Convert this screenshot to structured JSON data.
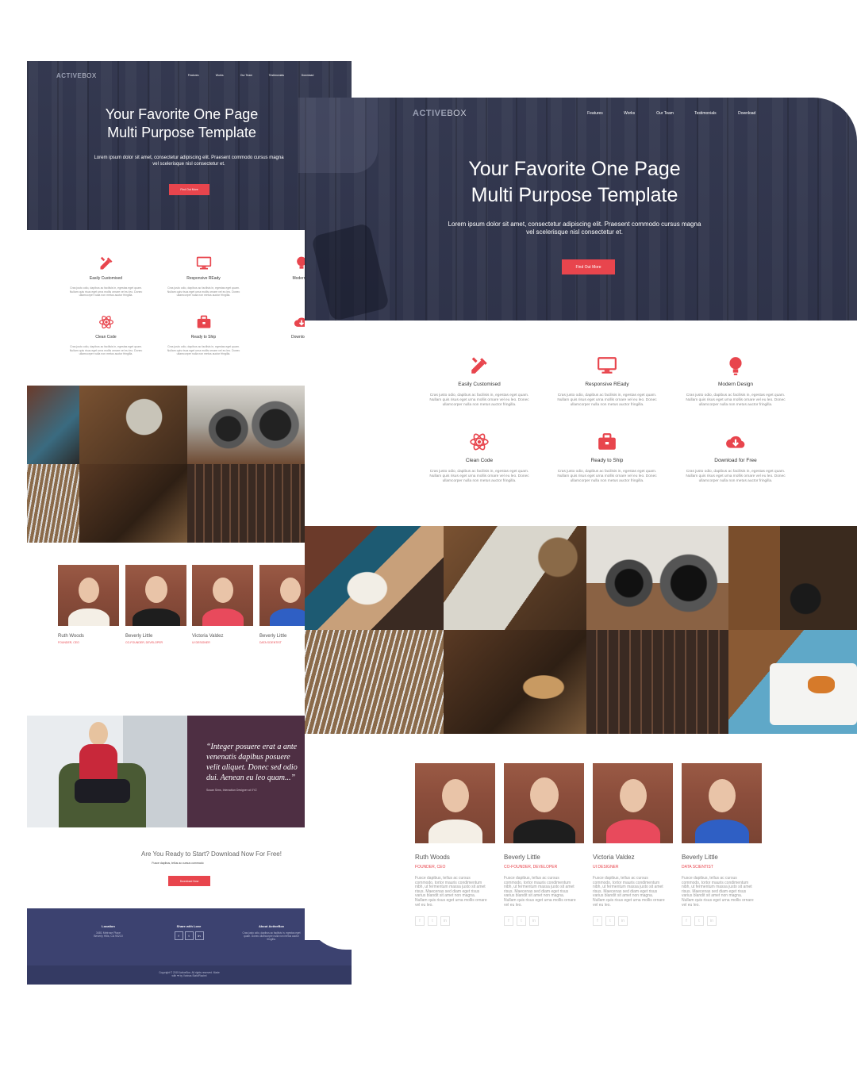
{
  "brand": {
    "part1": "ACTIVE",
    "part2": "BOX"
  },
  "nav": [
    "Features",
    "Works",
    "Our Team",
    "Testimonials",
    "Download"
  ],
  "hero": {
    "title_line1": "Your Favorite One Page",
    "title_line2": "Multi Purpose Template",
    "subtitle_line1": "Lorem ipsum dolor sit amet, consectetur adipiscing elit. Praesent commodo cursus magna",
    "subtitle_line2": "vel scelerisque nisl consectetur et.",
    "button": "Find Out More"
  },
  "features": [
    {
      "title": "Easily Customised",
      "icon": "pencil-ruler-icon"
    },
    {
      "title": "Responsive REady",
      "icon": "monitor-icon"
    },
    {
      "title": "Modern Design",
      "icon": "lightbulb-icon"
    },
    {
      "title": "Clean Code",
      "icon": "atom-icon"
    },
    {
      "title": "Ready to Ship",
      "icon": "briefcase-icon"
    },
    {
      "title": "Download for Free",
      "icon": "cloud-download-icon"
    }
  ],
  "features_small_partial": [
    "Modern D",
    "Download f"
  ],
  "feature_text_lines": [
    "Cras justo odio, dapibus ac facilisis in, egestas eget quam.",
    "Nullam quis risus eget urna mollis ornare vel eu leo. Donec",
    "ullamcorper nulla non metus auctor fringilla."
  ],
  "team": [
    {
      "name": "Ruth Woods",
      "role": "Founder, CEO"
    },
    {
      "name": "Beverly Little",
      "role": "Co-Founder, Developer"
    },
    {
      "name": "Victoria Valdez",
      "role": "UI Designer"
    },
    {
      "name": "Beverly Little",
      "role": "Data Scientist"
    }
  ],
  "team_text_lines": [
    "Fusce dapibus, tellus ac cursus",
    "commodo, tortor mauris condimentum",
    "nibh, ut fermentum massa justo sit amet",
    "risus. Maecenas sed diam eget risus",
    "varius blandit sit amet non magna.",
    "Nullam quis risus eget urna mollis ornare",
    "vel eu leo."
  ],
  "social_icons": [
    "f",
    "t",
    "in"
  ],
  "testimonial": {
    "quote_line1": "“Integer posuere erat a ante",
    "quote_line2": "venenatis dapibus posuere",
    "quote_line3": "velit aliquet. Donec sed odio",
    "quote_line4": "dui. Aenean eu leo quam...”",
    "author": "Susan Sims, Interaction Designer at XYZ"
  },
  "download": {
    "heading": "Are You Ready to Start? Download Now For Free!",
    "sub": "Fusce dapibus, tellus ac cursus commodo",
    "button": "Download Now"
  },
  "footer": {
    "col1_title": "Location",
    "col1_line1": "3481 Melrose Place",
    "col1_line2": "Beverly Hills, CA 90210",
    "col2_title": "Share with Love",
    "col3_title": "About ActiveBox",
    "col3_line1": "Cras justo odio, dapibus ac facilisis in, egestas eget",
    "col3_line2": "quam. Donec ullamcorper nulla non metus auctor",
    "col3_line3": "fringilla.",
    "copyright": "Copyright © 2015 ActiveBox. All rights reserved. Made",
    "credit": "with ❤ by Vorinas Stahl/Rachel"
  },
  "colors": {
    "accent": "#e8454d",
    "hero_bg": "#3b4058",
    "footer_bg": "#3c4270",
    "footer_bottom": "#343a63",
    "testimonial_bg": "#4e2f43"
  }
}
